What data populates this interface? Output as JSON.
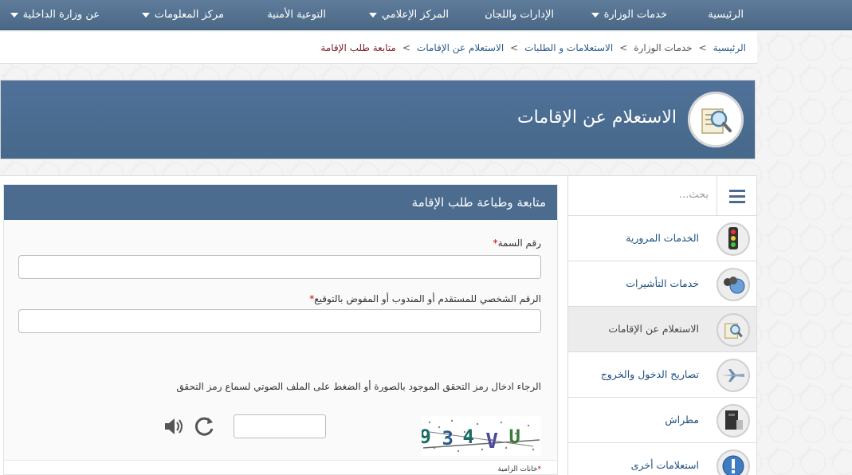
{
  "topnav": {
    "items": [
      {
        "label": "الرئيسية",
        "dropdown": false
      },
      {
        "label": "خدمات الوزارة",
        "dropdown": true
      },
      {
        "label": "الإدارات واللجان",
        "dropdown": false
      },
      {
        "label": "المركز الإعلامي",
        "dropdown": true
      },
      {
        "label": "التوعية الأمنية",
        "dropdown": false
      },
      {
        "label": "مركز المعلومات",
        "dropdown": true
      },
      {
        "label": "عن وزارة الداخلية",
        "dropdown": true
      }
    ]
  },
  "breadcrumb": {
    "items": [
      "الرئيسية",
      "خدمات الوزارة",
      "الاستعلامات و الطلبات",
      "الاستعلام عن الإقامات",
      "متابعة طلب الإقامة"
    ],
    "separators": [
      ">",
      ">",
      ">",
      ">"
    ]
  },
  "banner": {
    "title": "الاستعلام عن الإقامات",
    "icon": "magnifier-document-icon"
  },
  "sidebar": {
    "search_placeholder": "بحث...",
    "items": [
      {
        "label": "الخدمات المرورية",
        "icon": "traffic-light-icon",
        "active": false
      },
      {
        "label": "خدمات التأشيرات",
        "icon": "binoculars-globe-icon",
        "active": false
      },
      {
        "label": "الاستعلام عن الإقامات",
        "icon": "magnifier-document-icon",
        "active": true
      },
      {
        "label": "تصاريح الدخول والخروج",
        "icon": "airplane-icon",
        "active": false
      },
      {
        "label": "مطراش",
        "icon": "computer-icon",
        "active": false
      },
      {
        "label": "استعلامات أخرى",
        "icon": "exclamation-icon",
        "active": false
      }
    ]
  },
  "form": {
    "title": "متابعة وطباعة طلب الإقامة",
    "field1_label": "رقم السمة",
    "field1_value": "",
    "field2_label": "الرقم الشخصي للمستقدم أو المندوب أو المفوض بالتوقيع",
    "field2_value": "",
    "required_mark": "*",
    "hint": "الرجاء ادخال رمز التحقق الموجود بالصورة أو الضغط على الملف الصوتي لسماع رمز التحقق",
    "captcha_text": "934VU",
    "captcha_caption": "خانات الزامية",
    "captcha_value": ""
  },
  "colors": {
    "nav_bg": "#4f6f8f",
    "banner_bg": "#4b6c8f",
    "link": "#1d4f7f",
    "current_crumb": "#7a1f2b",
    "required": "#c00000"
  }
}
